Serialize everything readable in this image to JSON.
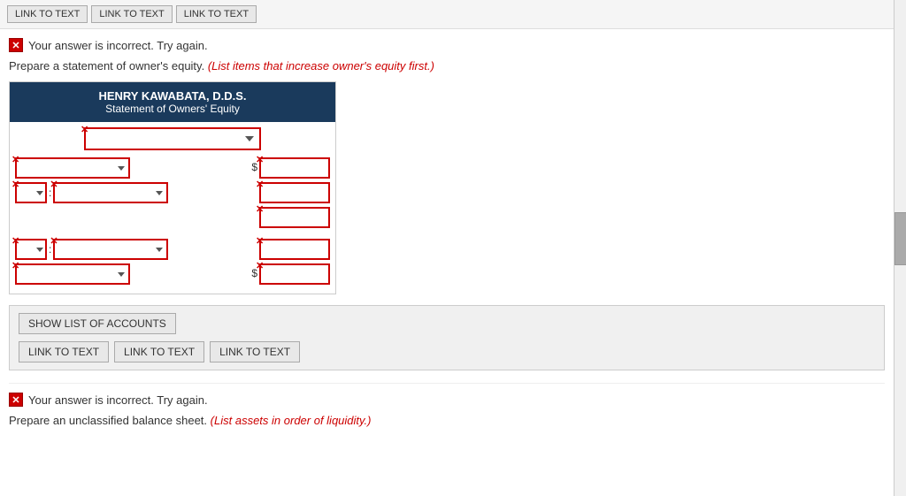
{
  "tabs": {
    "items": [
      "LINK TO TEXT",
      "LINK TO TEXT",
      "LINK TO TEXT"
    ]
  },
  "section1": {
    "incorrect_msg": "Your answer is incorrect.  Try again.",
    "instruction": "Prepare a statement of owner's equity.",
    "instruction_italic": "(List items that increase owner's equity first.)",
    "company_name": "HENRY KAWABATA, D.D.S.",
    "statement_title": "Statement of Owners' Equity",
    "show_accounts_label": "SHOW LIST OF ACCOUNTS",
    "link_buttons": [
      "LINK TO TEXT",
      "LINK TO TEXT",
      "LINK TO TEXT"
    ]
  },
  "section2": {
    "incorrect_msg": "Your answer is incorrect.  Try again.",
    "instruction": "Prepare an unclassified balance sheet.",
    "instruction_italic": "(List assets in order of liquidity.)"
  }
}
